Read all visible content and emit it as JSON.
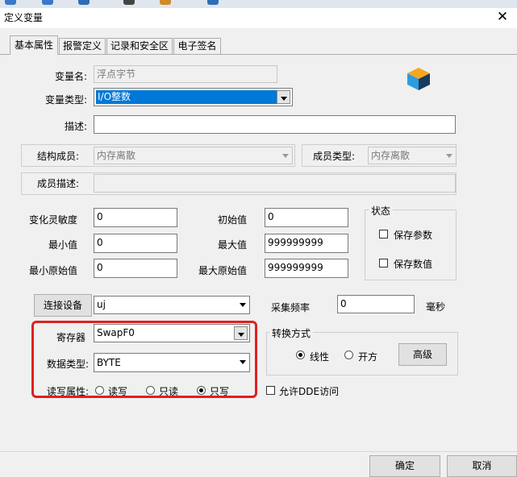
{
  "window": {
    "title": "定义变量",
    "close_label": "✕"
  },
  "tabs": [
    {
      "label": "基本属性",
      "active": true
    },
    {
      "label": "报警定义"
    },
    {
      "label": "记录和安全区"
    },
    {
      "label": "电子签名"
    }
  ],
  "fields": {
    "var_name": {
      "label": "变量名:",
      "value": "浮点字节"
    },
    "var_type": {
      "label": "变量类型:",
      "value": "I/O整数"
    },
    "desc": {
      "label": "描述:",
      "value": ""
    },
    "struct_member": {
      "label": "结构成员:",
      "value": "内存离散"
    },
    "member_type": {
      "label": "成员类型:",
      "value": "内存离散"
    },
    "member_desc": {
      "label": "成员描述:",
      "value": ""
    },
    "sensitivity": {
      "label": "变化灵敏度",
      "value": "0"
    },
    "initial": {
      "label": "初始值",
      "value": "0"
    },
    "min": {
      "label": "最小值",
      "value": "0"
    },
    "max": {
      "label": "最大值",
      "value": "999999999"
    },
    "min_raw": {
      "label": "最小原始值",
      "value": "0"
    },
    "max_raw": {
      "label": "最大原始值",
      "value": "999999999"
    },
    "device": {
      "button": "连接设备",
      "value": "uj"
    },
    "freq": {
      "label": "采集频率",
      "value": "0",
      "unit": "毫秒"
    },
    "register": {
      "label": "寄存器",
      "value": "SwapF0"
    },
    "data_type": {
      "label": "数据类型:",
      "value": "BYTE"
    },
    "rw": {
      "label": "读写属性:",
      "options": [
        "读写",
        "只读",
        "只写"
      ],
      "selected": "只写"
    }
  },
  "status_group": {
    "title": "状态",
    "items": [
      "保存参数",
      "保存数值"
    ]
  },
  "convert_group": {
    "title": "转换方式",
    "options": [
      "线性",
      "开方"
    ],
    "selected": "线性",
    "advanced": "高级"
  },
  "dde": {
    "label": "允许DDE访问"
  },
  "footer": {
    "ok": "确定",
    "cancel": "取消"
  },
  "colors": {
    "highlight": "#0078d7",
    "annotation": "#e02020"
  }
}
